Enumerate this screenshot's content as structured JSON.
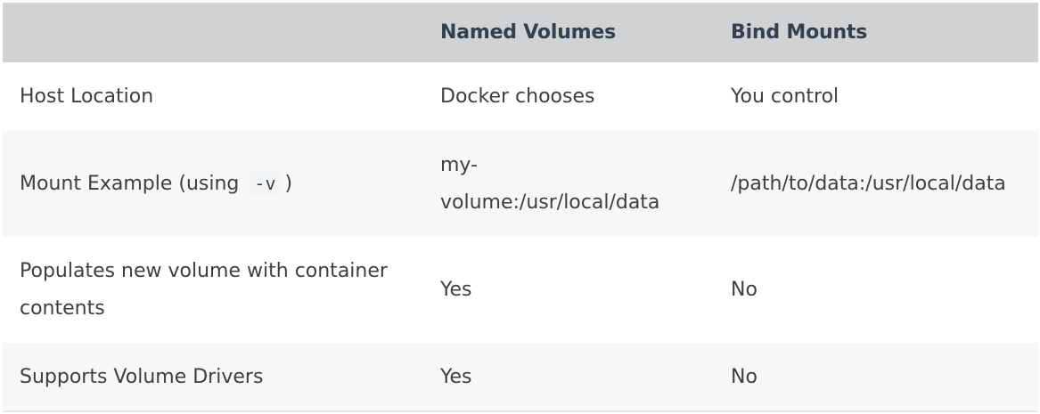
{
  "table": {
    "headers": [
      "",
      "Named Volumes",
      "Bind Mounts"
    ],
    "rows": [
      {
        "label": "Host Location",
        "named": "Docker chooses",
        "bind": "You control"
      },
      {
        "label_prefix": "Mount Example (using",
        "label_code": "-v",
        "label_suffix": ")",
        "named": "my-volume:/usr/local/data",
        "bind": "/path/to/data:/usr/local/data"
      },
      {
        "label": "Populates new volume with container contents",
        "named": "Yes",
        "bind": "No"
      },
      {
        "label": "Supports Volume Drivers",
        "named": "Yes",
        "bind": "No"
      }
    ]
  },
  "colors": {
    "header_bg": "#d1d2d4",
    "stripe_bg": "#f7f7f7",
    "text": "#3c4043"
  }
}
